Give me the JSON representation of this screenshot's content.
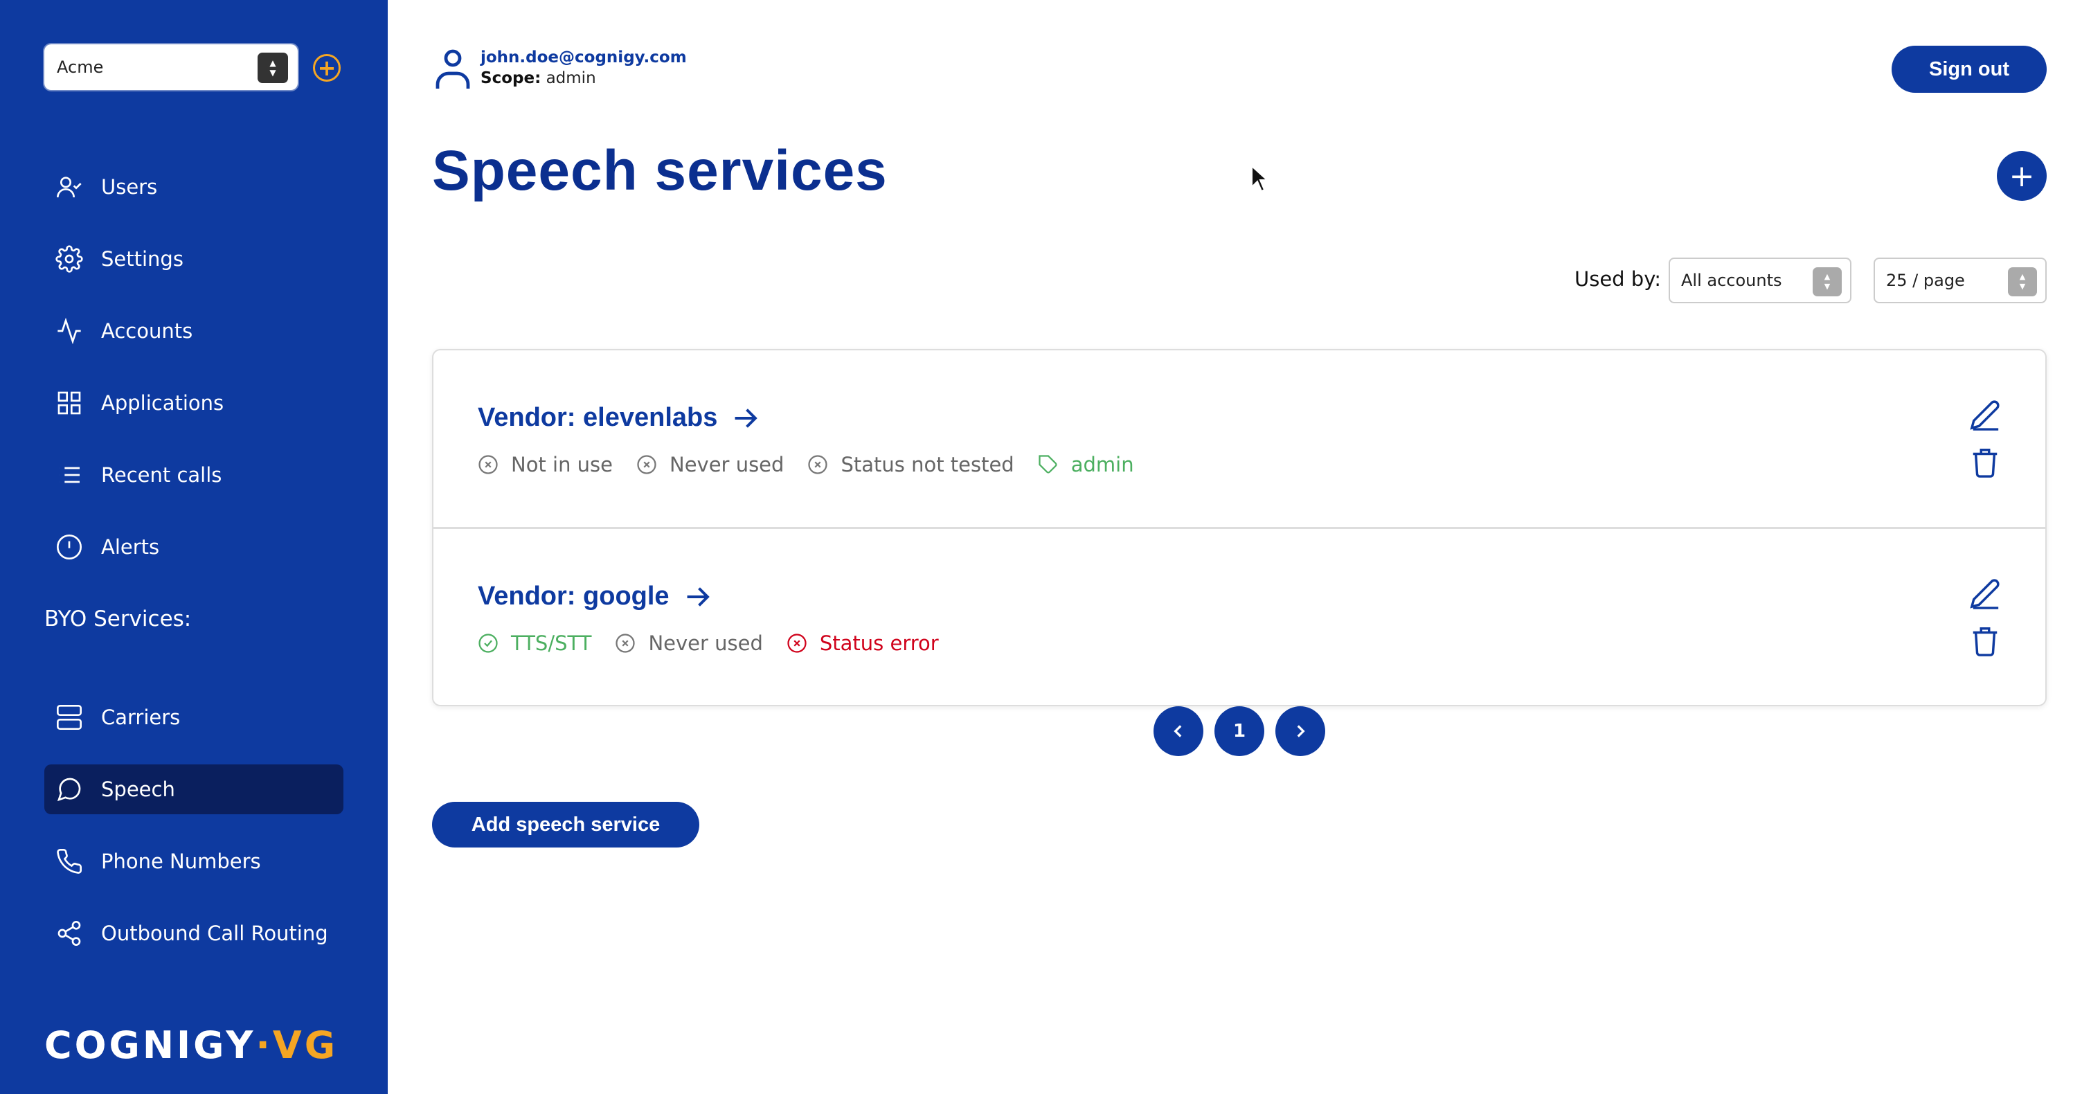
{
  "sidebar": {
    "account_select": {
      "value": "Acme"
    },
    "items": [
      {
        "label": "Users",
        "icon": "user-check-icon"
      },
      {
        "label": "Settings",
        "icon": "gear-icon"
      },
      {
        "label": "Accounts",
        "icon": "activity-icon"
      },
      {
        "label": "Applications",
        "icon": "grid-icon"
      },
      {
        "label": "Recent calls",
        "icon": "list-icon"
      },
      {
        "label": "Alerts",
        "icon": "alert-circle-icon"
      }
    ],
    "byo_label": "BYO Services:",
    "byo_items": [
      {
        "label": "Carriers",
        "icon": "server-icon"
      },
      {
        "label": "Speech",
        "icon": "message-circle-icon",
        "active": true
      },
      {
        "label": "Phone Numbers",
        "icon": "phone-icon"
      },
      {
        "label": "Outbound Call Routing",
        "icon": "share-icon"
      }
    ],
    "logo": {
      "left": "COGNIGY",
      "dot": "·",
      "right": "VG"
    }
  },
  "header": {
    "email": "john.doe@cognigy.com",
    "scope_label": "Scope:",
    "scope_value": "admin",
    "signout_label": "Sign out"
  },
  "main": {
    "title": "Speech services",
    "filters": {
      "used_by_label": "Used by:",
      "used_by_value": "All accounts",
      "per_page_value": "25 / page"
    },
    "services": [
      {
        "vendor": "Vendor: elevenlabs",
        "statuses": [
          {
            "text": "Not in use",
            "kind": "neutral"
          },
          {
            "text": "Never used",
            "kind": "neutral"
          },
          {
            "text": "Status not tested",
            "kind": "neutral"
          },
          {
            "text": "admin",
            "kind": "tag"
          }
        ]
      },
      {
        "vendor": "Vendor: google",
        "statuses": [
          {
            "text": "TTS/STT",
            "kind": "ok"
          },
          {
            "text": "Never used",
            "kind": "neutral"
          },
          {
            "text": "Status error",
            "kind": "err"
          }
        ]
      }
    ],
    "pagination": {
      "current": "1"
    },
    "add_label": "Add speech service"
  },
  "colors": {
    "brand": "#0e3aa0",
    "accent": "#f5a623",
    "ok": "#4caf60",
    "error": "#d0021b"
  }
}
